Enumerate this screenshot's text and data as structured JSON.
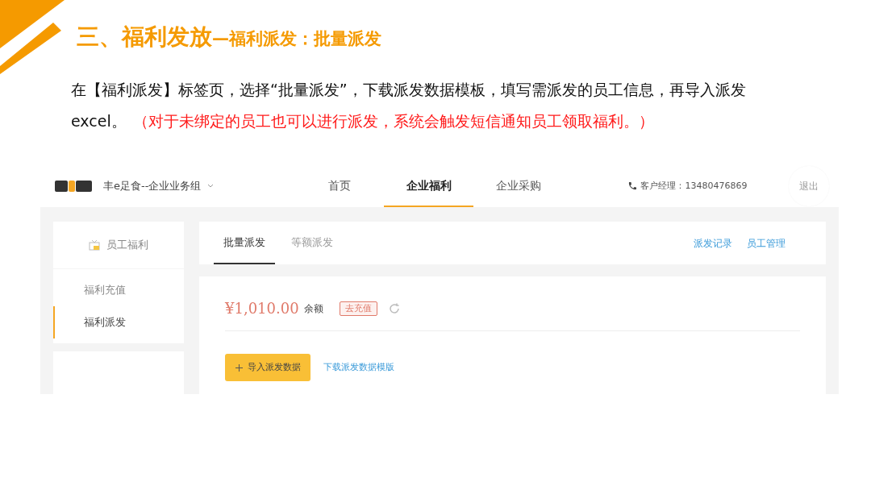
{
  "slide": {
    "title_main": "三、福利发放",
    "title_sub": "—福利派发：批量派发",
    "intro": "在【福利派发】标签页，选择“批量派发”，下载派发数据模板，填写需派发的员工信息，再导入派发",
    "intro_end": "excel。",
    "note": "（对于未绑定的员工也可以进行派发，系统会触发短信通知员工领取福利。）"
  },
  "header": {
    "brand": "丰e足食--企业业务组",
    "nav": [
      {
        "label": "首页",
        "selected": false
      },
      {
        "label": "企业福利",
        "selected": true
      },
      {
        "label": "企业采购",
        "selected": false
      }
    ],
    "contact": "客户经理：13480476869",
    "logout": "退出"
  },
  "sidebar": {
    "heading": "员工福利",
    "items": [
      {
        "label": "福利充值",
        "selected": false
      },
      {
        "label": "福利派发",
        "selected": true
      }
    ]
  },
  "tabs": [
    {
      "label": "批量派发",
      "selected": true
    },
    {
      "label": "等额派发",
      "selected": false
    }
  ],
  "links": [
    "派发记录",
    "员工管理"
  ],
  "balance": {
    "amount": "¥1,010.00",
    "label": "余额",
    "recharge": "去充值"
  },
  "import_button": "导入派发数据",
  "template_link": "下载派发数据模版"
}
